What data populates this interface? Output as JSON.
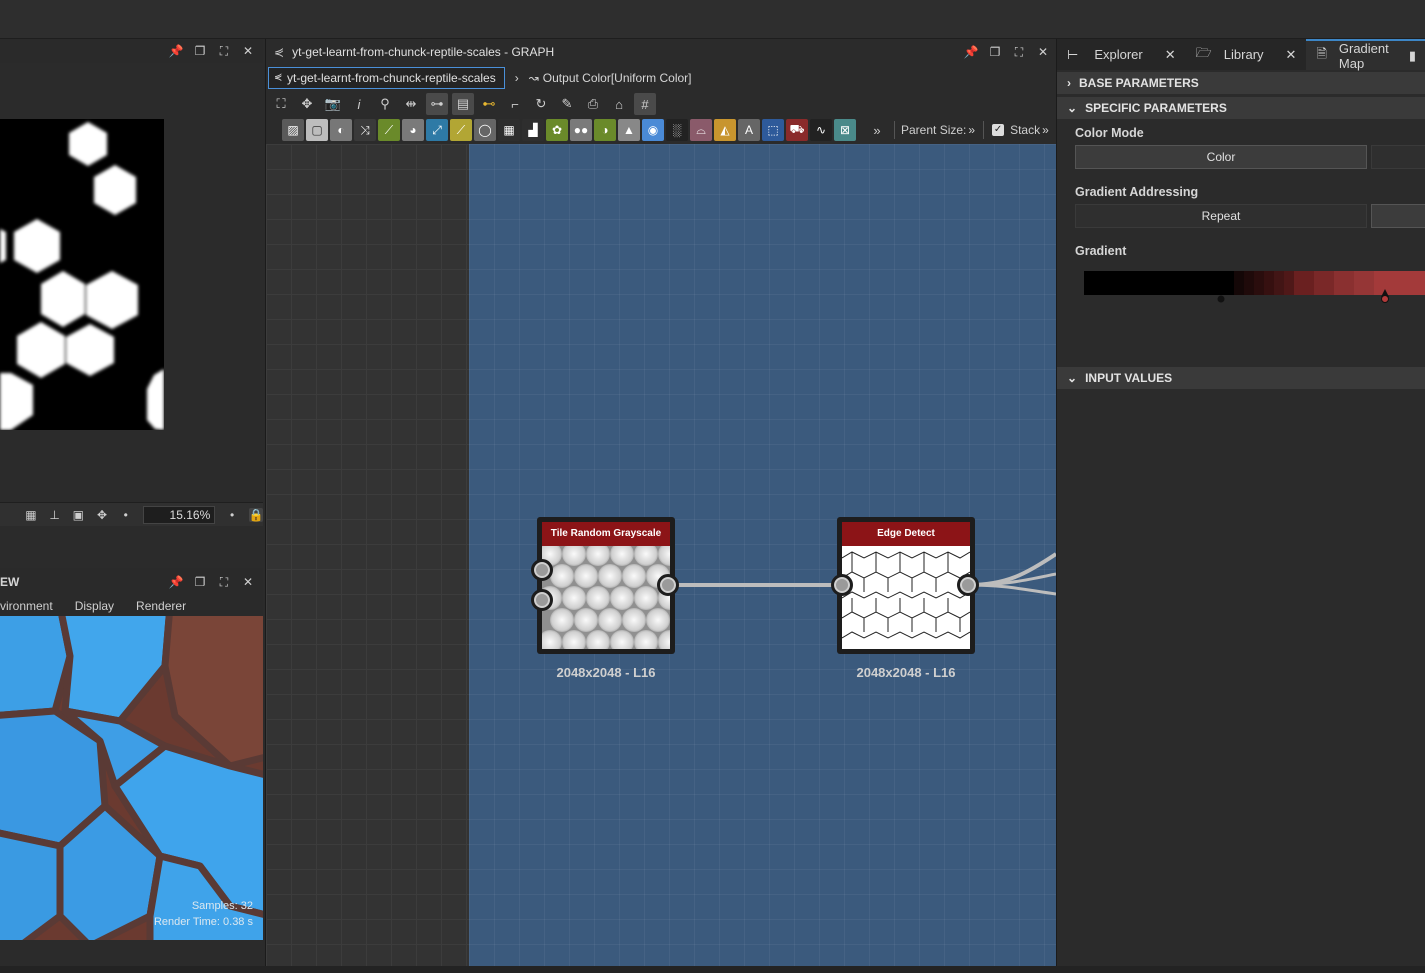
{
  "left_panel": {
    "zoom": "15.16%",
    "view3d_title": "EW",
    "view3d_menu": [
      "vironment",
      "Display",
      "Renderer"
    ],
    "samples": "Samples: 32",
    "render_time": "Render Time: 0.38 s"
  },
  "graph": {
    "title": "yt-get-learnt-from-chunck-reptile-scales - GRAPH",
    "breadcrumb_tab": "yt-get-learnt-from-chunck-reptile-scales",
    "breadcrumb_output": "Output Color[Uniform Color]",
    "parent_size": "Parent Size:",
    "stack": "Stack",
    "nodes": [
      {
        "title": "Tile Random Grayscale",
        "caption": "2048x2048 - L16"
      },
      {
        "title": "Edge Detect",
        "caption": "2048x2048 - L16"
      }
    ]
  },
  "right_panel": {
    "tabs": [
      "Explorer",
      "Library",
      "Gradient Map"
    ],
    "sections": {
      "base": "BASE PARAMETERS",
      "specific": "SPECIFIC PARAMETERS",
      "inputs": "INPUT VALUES"
    },
    "color_mode": {
      "label": "Color Mode",
      "value": "Color"
    },
    "addressing": {
      "label": "Gradient Addressing",
      "value": "Repeat"
    },
    "gradient_label": "Gradient"
  },
  "colors": {
    "accent": "#3d86c6",
    "node_header": "#8c1417",
    "frame": "#3b5a7d"
  }
}
